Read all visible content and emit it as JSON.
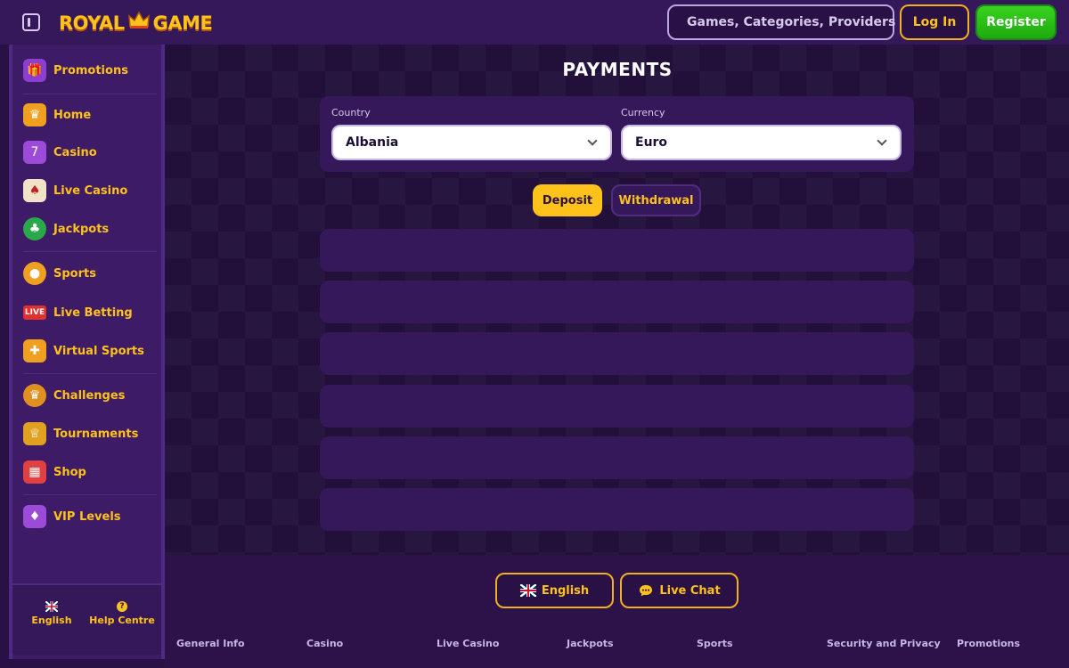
{
  "header": {
    "logo_left": "ROYAL",
    "logo_right": "GAME",
    "search_placeholder": "Games, Categories, Providers",
    "login_label": "Log In",
    "register_label": "Register"
  },
  "sidebar": {
    "items": [
      {
        "label": "Promotions",
        "icon": "promotions-icon"
      },
      {
        "label": "Home",
        "icon": "home-icon"
      },
      {
        "label": "Casino",
        "icon": "slot-machine-icon"
      },
      {
        "label": "Live Casino",
        "icon": "cards-icon"
      },
      {
        "label": "Jackpots",
        "icon": "clover-icon"
      },
      {
        "label": "Sports",
        "icon": "ball-icon"
      },
      {
        "label": "Live Betting",
        "icon": "live-badge-icon"
      },
      {
        "label": "Virtual Sports",
        "icon": "gamepad-icon"
      },
      {
        "label": "Challenges",
        "icon": "challenges-icon"
      },
      {
        "label": "Tournaments",
        "icon": "trophy-icon"
      },
      {
        "label": "Shop",
        "icon": "shop-icon"
      },
      {
        "label": "VIP Levels",
        "icon": "vip-icon"
      }
    ],
    "live_badge": "LIVE",
    "bottom": {
      "language_label": "English",
      "help_label": "Help Centre",
      "help_glyph": "?"
    }
  },
  "main": {
    "title": "PAYMENTS",
    "country_label": "Country",
    "country_value": "Albania",
    "currency_label": "Currency",
    "currency_value": "Euro",
    "tabs": {
      "deposit": "Deposit",
      "withdrawal": "Withdrawal"
    },
    "active_tab": "deposit"
  },
  "footer": {
    "language_button": "English",
    "live_chat_button": "Live Chat",
    "links": [
      "General Info",
      "Casino",
      "Live Casino",
      "Jackpots",
      "Sports",
      "Security and Privacy",
      "Promotions"
    ]
  },
  "colors": {
    "accent": "#ffc21a",
    "register": "#2fbf17",
    "background": "#2a1145",
    "panel": "#35185a"
  }
}
